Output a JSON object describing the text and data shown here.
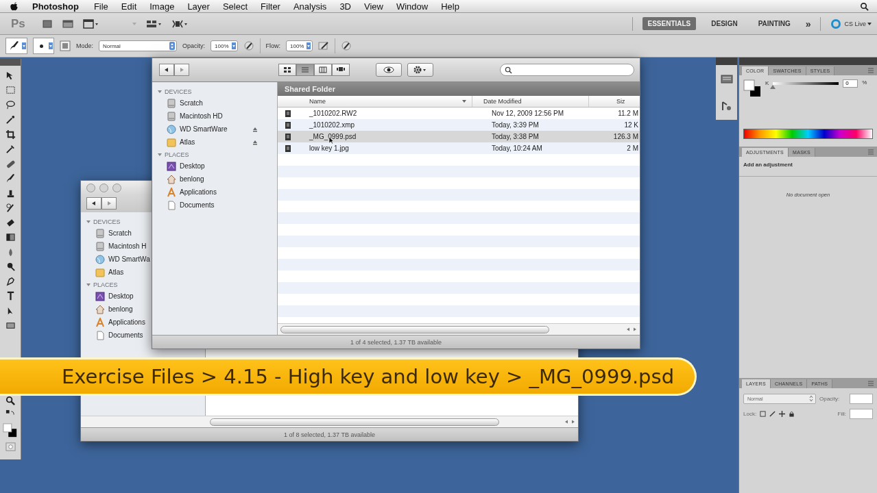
{
  "menu_bar": {
    "app_name": "Photoshop",
    "menus": [
      "File",
      "Edit",
      "Image",
      "Layer",
      "Select",
      "Filter",
      "Analysis",
      "3D",
      "View",
      "Window",
      "Help"
    ]
  },
  "app_bar": {
    "logo": "Ps",
    "workspaces": [
      {
        "label": "ESSENTIALS",
        "selected": true
      },
      {
        "label": "DESIGN",
        "selected": false
      },
      {
        "label": "PAINTING",
        "selected": false
      }
    ],
    "more": "»",
    "cs_live": "CS Live"
  },
  "options_bar": {
    "mode_label": "Mode:",
    "mode": "Normal",
    "opacity_label": "Opacity:",
    "opacity": "100%",
    "flow_label": "Flow:",
    "flow": "100%"
  },
  "finder_back": {
    "sidebar": [
      {
        "heading": "DEVICES",
        "items": [
          {
            "label": "Scratch",
            "kind": "drive"
          },
          {
            "label": "Macintosh H",
            "kind": "drive"
          },
          {
            "label": "WD SmartWa",
            "kind": "globe"
          },
          {
            "label": "Atlas",
            "kind": "folder"
          }
        ]
      },
      {
        "heading": "PLACES",
        "items": [
          {
            "label": "Desktop",
            "kind": "desktop"
          },
          {
            "label": "benlong",
            "kind": "home"
          },
          {
            "label": "Applications",
            "kind": "apps"
          },
          {
            "label": "Documents",
            "kind": "docs"
          }
        ]
      }
    ],
    "status": "1 of 8 selected, 1.37 TB available"
  },
  "finder_front": {
    "view_modes": [
      {
        "kind": "icons",
        "selected": false
      },
      {
        "kind": "list",
        "selected": true
      },
      {
        "kind": "columns",
        "selected": false
      },
      {
        "kind": "coverflow",
        "selected": false
      }
    ],
    "sidebar": [
      {
        "heading": "DEVICES",
        "items": [
          {
            "label": "Scratch",
            "kind": "drive",
            "eject": false
          },
          {
            "label": "Macintosh HD",
            "kind": "drive",
            "eject": false
          },
          {
            "label": "WD SmartWare",
            "kind": "globe",
            "eject": true
          },
          {
            "label": "Atlas",
            "kind": "folder",
            "eject": true
          }
        ]
      },
      {
        "heading": "PLACES",
        "items": [
          {
            "label": "Desktop",
            "kind": "desktop",
            "eject": false
          },
          {
            "label": "benlong",
            "kind": "home",
            "eject": false
          },
          {
            "label": "Applications",
            "kind": "apps",
            "eject": false
          },
          {
            "label": "Documents",
            "kind": "docs",
            "eject": false
          }
        ]
      }
    ],
    "folder_title": "Shared Folder",
    "columns": [
      "Name",
      "Date Modified",
      "Siz"
    ],
    "rows": [
      {
        "name": "_1010202.RW2",
        "date": "Nov 12, 2009 12:56 PM",
        "size": "11.2 M",
        "selected": false
      },
      {
        "name": "_1010202.xmp",
        "date": "Today, 3:39 PM",
        "size": "12 K",
        "selected": false
      },
      {
        "name": "_MG_0999.psd",
        "date": "Today, 3:38 PM",
        "size": "126.3 M",
        "selected": true
      },
      {
        "name": "low key 1.jpg",
        "date": "Today, 10:24 AM",
        "size": "2 M",
        "selected": false
      }
    ],
    "status": "1 of 4 selected, 1.37 TB available"
  },
  "panels": {
    "color": {
      "tabs": [
        {
          "label": "COLOR",
          "selected": true
        },
        {
          "label": "SWATCHES",
          "selected": false
        },
        {
          "label": "STYLES",
          "selected": false
        }
      ],
      "channel": "K",
      "level": 0,
      "value": "0",
      "unit": "%"
    },
    "adjustments": {
      "tabs": [
        {
          "label": "ADJUSTMENTS",
          "selected": true
        },
        {
          "label": "MASKS",
          "selected": false
        }
      ],
      "title": "Add an adjustment",
      "message": "No document open"
    },
    "layers": {
      "tabs": [
        {
          "label": "LAYERS",
          "selected": true
        },
        {
          "label": "CHANNELS",
          "selected": false
        },
        {
          "label": "PATHS",
          "selected": false
        }
      ],
      "blend_mode": "Normal",
      "opacity_label": "Opacity:",
      "lock_label": "Lock:",
      "fill_label": "Fill:"
    }
  },
  "banner": "Exercise Files > 4.15 - High key and low key > _MG_0999.psd"
}
